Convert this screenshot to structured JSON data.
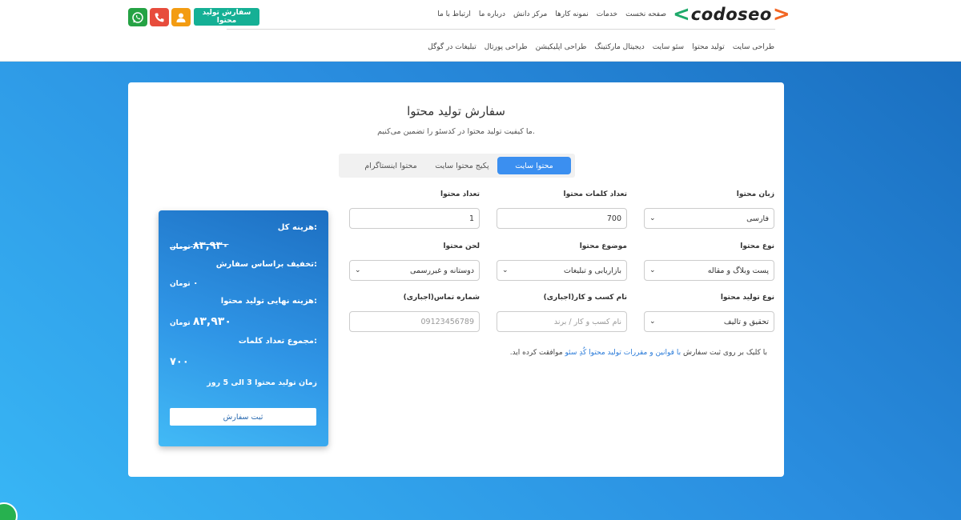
{
  "header": {
    "logo": {
      "text": "codoseo",
      "left_chevron": "<",
      "right_chevron": ">"
    },
    "top_nav": [
      "صفحه نخست",
      "خدمات",
      "نمونه کارها",
      "مرکز دانش",
      "درباره ما",
      "ارتباط با ما"
    ],
    "sub_nav": [
      "طراحی سایت",
      "تولید محتوا",
      "سئو سایت",
      "دیجیتال مارکتینگ",
      "طراحی اپلیکیشن",
      "طراحی پورتال",
      "تبلیغات در گوگل"
    ],
    "order_button": "سفارش تولید محتوا",
    "colors": {
      "order_button": "#15b095",
      "user_icon": "#f39c12",
      "phone_icon": "#e74c3c",
      "whatsapp_icon": "#25a244"
    }
  },
  "form": {
    "title": "سفارش تولید محتوا",
    "subtitle": "ما کیفیت تولید محتوا در کدسئو را تضمین می‌کنیم.",
    "tabs": [
      {
        "label": "محتوا سایت",
        "active": true
      },
      {
        "label": "پکیج محتوا سایت",
        "active": false
      },
      {
        "label": "محتوا اینستاگرام",
        "active": false
      }
    ],
    "fields": {
      "language": {
        "label": "زبان محتوا",
        "value": "فارسی"
      },
      "word_count": {
        "label": "تعداد کلمات محتوا",
        "value": "700"
      },
      "content_count": {
        "label": "تعداد محتوا",
        "value": "1"
      },
      "content_type": {
        "label": "نوع محتوا",
        "value": "پست وبلاگ و مقاله"
      },
      "content_topic": {
        "label": "موضوع محتوا",
        "value": "بازاریابی و تبلیغات"
      },
      "content_tone": {
        "label": "لحن محتوا",
        "value": "دوستانه و غیررسمی"
      },
      "production_type": {
        "label": "نوع تولید محتوا",
        "value": "تحقیق و تالیف"
      },
      "business_name": {
        "label": "نام کسب و کار(اجباری)",
        "placeholder": "نام کسب و کار / برند"
      },
      "phone": {
        "label": "شماره تماس(اجباری)",
        "placeholder": "09123456789"
      }
    },
    "terms": {
      "prefix": "با کلیک بر روی ثبت سفارش",
      "link": "با قوانین و مقررات تولید محتوا کُدِ سئو",
      "suffix": "موافقت کرده اید."
    }
  },
  "summary": {
    "total_label": "هزینه کل:",
    "total_value": "۸۳,۹۳۰",
    "discount_label": "تخفیف براساس سفارش:",
    "discount_value": "۰",
    "final_label": "هزینه نهایی تولید محتوا:",
    "final_value": "۸۳,۹۳۰",
    "words_label": "مجموع تعداد کلمات:",
    "words_value": "۷۰۰",
    "currency": "تومان",
    "delivery_text": "زمان تولید محتوا 3 الی 5 روز",
    "submit_button": "ثبت سفارش"
  },
  "icons": [
    "user-icon",
    "phone-icon",
    "whatsapp-icon",
    "chevron-down-icon"
  ]
}
